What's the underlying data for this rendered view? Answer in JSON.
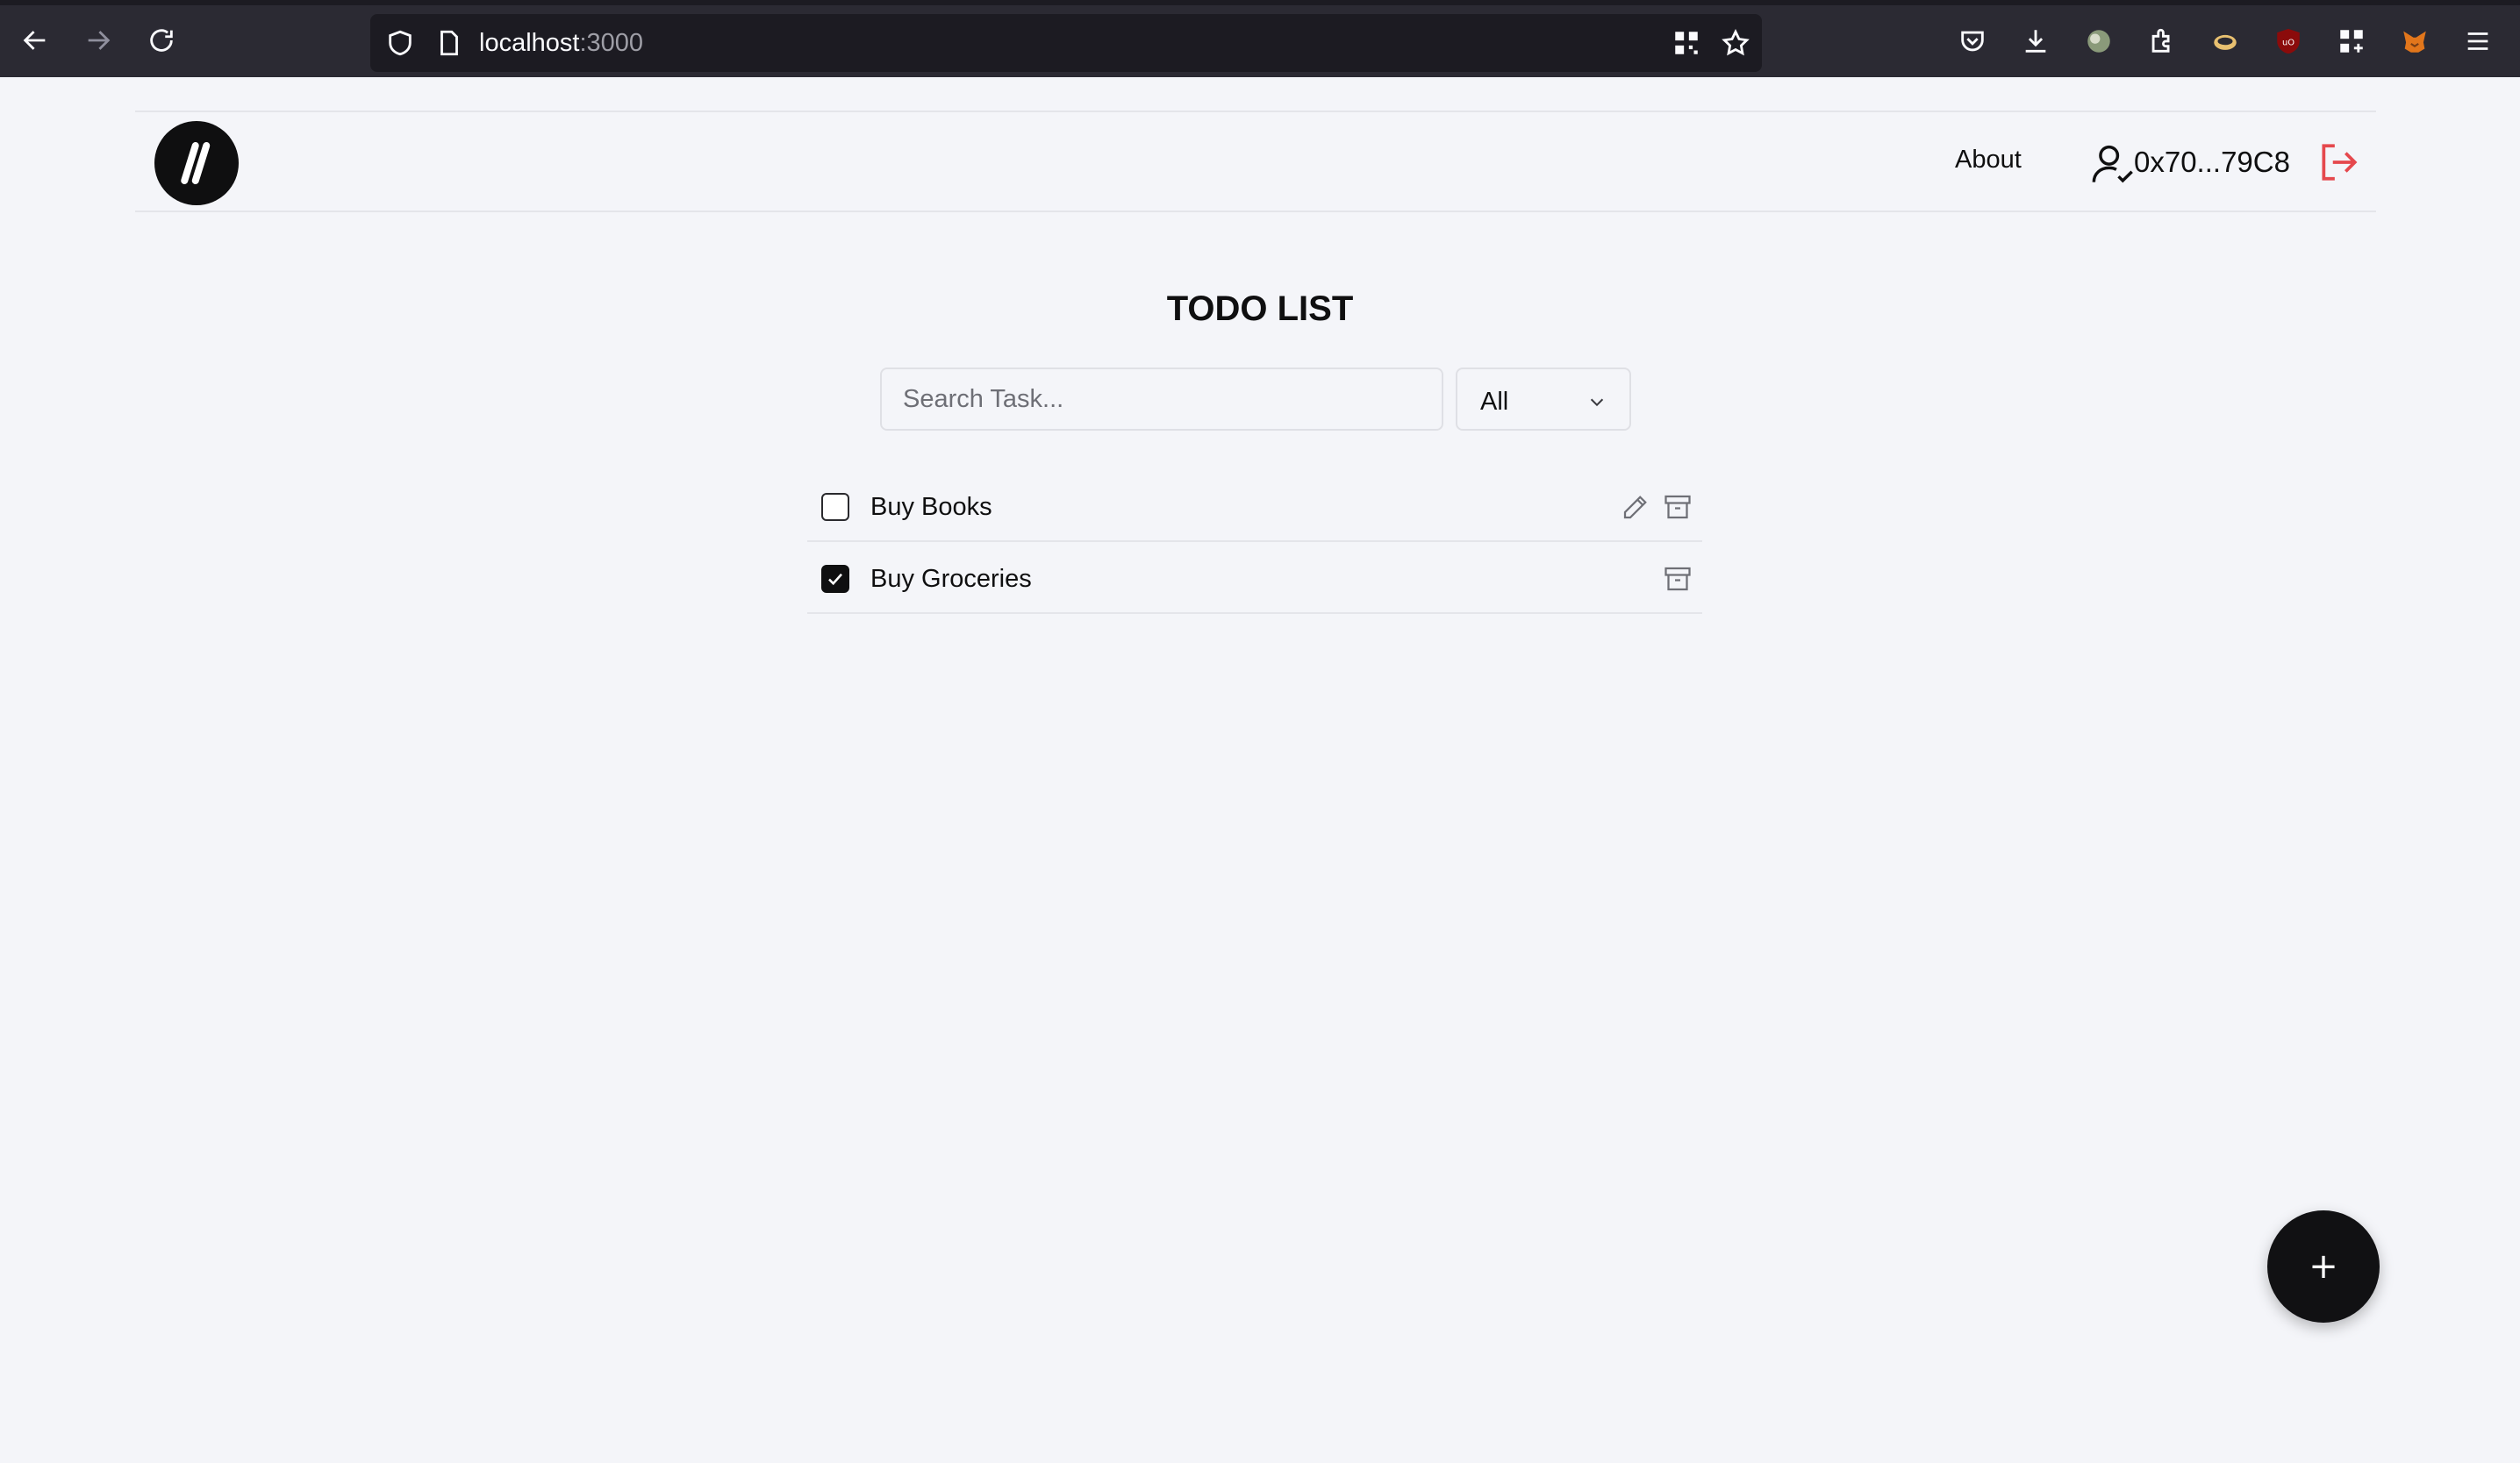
{
  "browser": {
    "url_host": "localhost",
    "url_port": ":3000"
  },
  "header": {
    "about_label": "About",
    "wallet_address": "0x70...79C8"
  },
  "main": {
    "title": "TODO LIST",
    "search_placeholder": "Search Task...",
    "filter_selected": "All",
    "tasks": [
      {
        "label": "Buy Books",
        "completed": false
      },
      {
        "label": "Buy Groceries",
        "completed": true
      }
    ],
    "fab_label": "+"
  },
  "colors": {
    "background": "#f4f5f9",
    "logout_accent": "#e5484d",
    "primary": "#0f0f10"
  }
}
